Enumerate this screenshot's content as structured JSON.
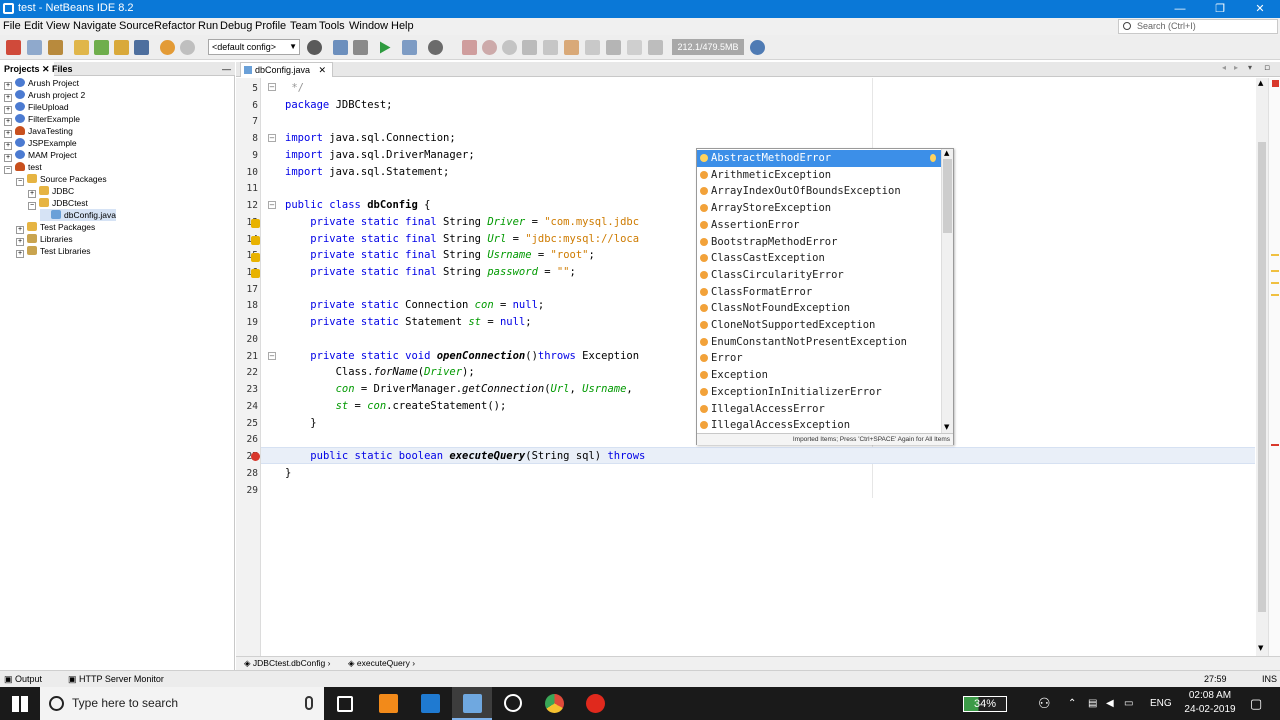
{
  "window": {
    "title": "test - NetBeans IDE 8.2",
    "minimize": "—",
    "maximize": "❐",
    "close": "✕"
  },
  "menu": {
    "items": [
      "File",
      "Edit",
      "View",
      "Navigate",
      "Source",
      "Refactor",
      "Run",
      "Debug",
      "Profile",
      "Team",
      "Tools",
      "Window",
      "Help"
    ],
    "search_placeholder": "Search (Ctrl+I)"
  },
  "toolbar": {
    "config": "<default config>",
    "memory": "212.1/479.5MB"
  },
  "projects_panel": {
    "tabs": [
      "Projects",
      "Files"
    ],
    "tree": [
      {
        "label": "Arush Project",
        "depth": 0,
        "toggle": "+",
        "icon": "globe"
      },
      {
        "label": "Arush project 2",
        "depth": 0,
        "toggle": "+",
        "icon": "globe"
      },
      {
        "label": "FileUpload",
        "depth": 0,
        "toggle": "+",
        "icon": "globe"
      },
      {
        "label": "FilterExample",
        "depth": 0,
        "toggle": "+",
        "icon": "globe"
      },
      {
        "label": "JavaTesting",
        "depth": 0,
        "toggle": "+",
        "icon": "cup"
      },
      {
        "label": "JSPExample",
        "depth": 0,
        "toggle": "+",
        "icon": "globe"
      },
      {
        "label": "MAM Project",
        "depth": 0,
        "toggle": "+",
        "icon": "globe"
      },
      {
        "label": "test",
        "depth": 0,
        "toggle": "−",
        "icon": "cup"
      },
      {
        "label": "Source Packages",
        "depth": 1,
        "toggle": "−",
        "icon": "pkg"
      },
      {
        "label": "JDBC",
        "depth": 2,
        "toggle": "+",
        "icon": "pkg"
      },
      {
        "label": "JDBCtest",
        "depth": 2,
        "toggle": "−",
        "icon": "pkg"
      },
      {
        "label": "dbConfig.java",
        "depth": 3,
        "toggle": "",
        "icon": "java",
        "selected": true
      },
      {
        "label": "Test Packages",
        "depth": 1,
        "toggle": "+",
        "icon": "pkg"
      },
      {
        "label": "Libraries",
        "depth": 1,
        "toggle": "+",
        "icon": "lib"
      },
      {
        "label": "Test Libraries",
        "depth": 1,
        "toggle": "+",
        "icon": "lib"
      }
    ]
  },
  "editor": {
    "tab": "dbConfig.java",
    "lines": [
      {
        "n": "5",
        "html": "<span class=\"cmt\"> */</span>"
      },
      {
        "n": "6",
        "html": "<span class=\"kw\">package</span> JDBCtest;"
      },
      {
        "n": "7",
        "html": ""
      },
      {
        "n": "8",
        "html": "<span class=\"kw\">import</span> java.sql.Connection;"
      },
      {
        "n": "9",
        "html": "<span class=\"kw\">import</span> java.sql.DriverManager;"
      },
      {
        "n": "10",
        "html": "<span class=\"kw\">import</span> java.sql.Statement;"
      },
      {
        "n": "11",
        "html": ""
      },
      {
        "n": "12",
        "html": "<span class=\"kw\">public class</span> <span class=\"bold\">dbConfig</span> {"
      },
      {
        "n": "13",
        "html": "    <span class=\"kw\">private static final</span> String <span class=\"fld\">Driver</span> = <span class=\"str\">\"com.mysql.jdbc</span>"
      },
      {
        "n": "14",
        "html": "    <span class=\"kw\">private static final</span> String <span class=\"fld\">Url</span> = <span class=\"str\">\"jdbc:mysql://loca</span>"
      },
      {
        "n": "15",
        "html": "    <span class=\"kw\">private static final</span> String <span class=\"fld\">Usrname</span> = <span class=\"str\">\"root\"</span>;"
      },
      {
        "n": "16",
        "html": "    <span class=\"kw\">private static final</span> String <span class=\"fld\">password</span> = <span class=\"str\">\"\"</span>;"
      },
      {
        "n": "17",
        "html": ""
      },
      {
        "n": "18",
        "html": "    <span class=\"kw\">private static</span> Connection <span class=\"fld\">con</span> = <span class=\"kw\">null</span>;"
      },
      {
        "n": "19",
        "html": "    <span class=\"kw\">private static</span> Statement <span class=\"fld\">st</span> = <span class=\"kw\">null</span>;"
      },
      {
        "n": "20",
        "html": ""
      },
      {
        "n": "21",
        "html": "    <span class=\"kw\">private static void</span> <span class=\"bold ital\">openConnection</span>()<span class=\"kw\">throws</span> Exception"
      },
      {
        "n": "22",
        "html": "        Class.<span class=\"ital\">forName</span>(<span class=\"fld\">Driver</span>);"
      },
      {
        "n": "23",
        "html": "        <span class=\"fld\">con</span> = DriverManager.<span class=\"ital\">getConnection</span>(<span class=\"fld\">Url</span>, <span class=\"fld\">Usrname</span>,"
      },
      {
        "n": "24",
        "html": "        <span class=\"fld\">st</span> = <span class=\"fld\">con</span>.createStatement();"
      },
      {
        "n": "25",
        "html": "    }"
      },
      {
        "n": "26",
        "html": ""
      },
      {
        "n": "27",
        "html": "    <span class=\"kw\">public static boolean</span> <span class=\"bold ital\">executeQuery</span>(String sql) <span class=\"kw\">throws</span>"
      },
      {
        "n": "28",
        "html": "}"
      },
      {
        "n": "29",
        "html": ""
      }
    ]
  },
  "completion": {
    "items": [
      "AbstractMethodError",
      "ArithmeticException",
      "ArrayIndexOutOfBoundsException",
      "ArrayStoreException",
      "AssertionError",
      "BootstrapMethodError",
      "ClassCastException",
      "ClassCircularityError",
      "ClassFormatError",
      "ClassNotFoundException",
      "CloneNotSupportedException",
      "EnumConstantNotPresentException",
      "Error",
      "Exception",
      "ExceptionInInitializerError",
      "IllegalAccessError",
      "IllegalAccessException"
    ],
    "footer": "Imported Items; Press 'Ctrl+SPACE' Again for All Items"
  },
  "breadcrumb": [
    "JDBCtest.dbConfig",
    "executeQuery"
  ],
  "statusbar": {
    "output": "Output",
    "http": "HTTP Server Monitor",
    "position": "27:59",
    "mode": "INS"
  },
  "taskbar": {
    "search_placeholder": "Type here to search",
    "battery": "34%",
    "lang": "ENG",
    "time": "02:08 AM",
    "date": "24-02-2019"
  }
}
